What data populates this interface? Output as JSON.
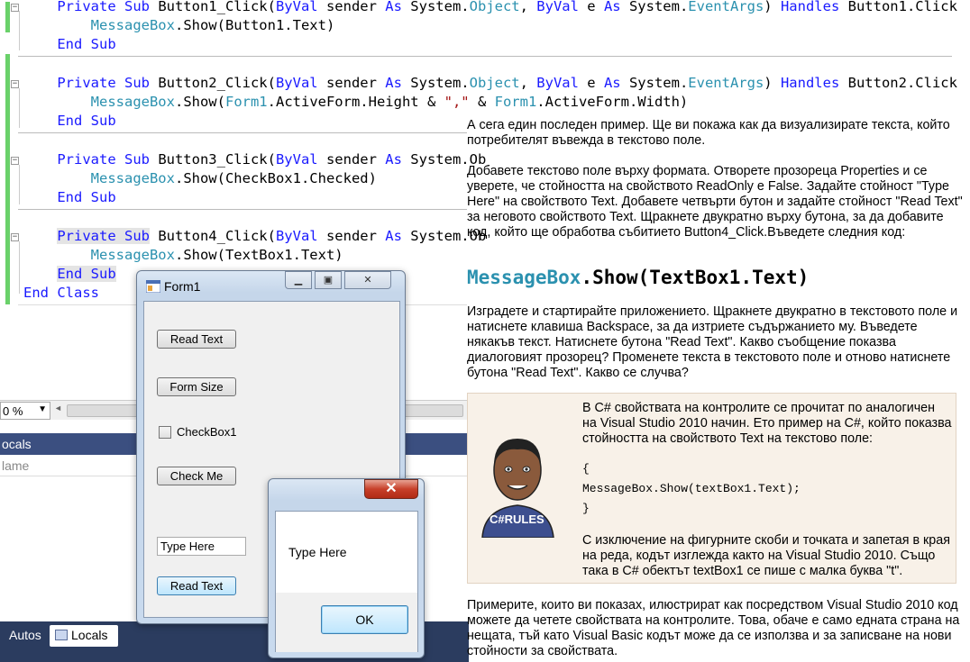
{
  "editor": {
    "lines": [
      {
        "segments": [
          {
            "t": "    "
          },
          {
            "t": "Private Sub",
            "c": "kw"
          },
          {
            "t": " Button1_Click("
          },
          {
            "t": "ByVal",
            "c": "kw"
          },
          {
            "t": " sender "
          },
          {
            "t": "As",
            "c": "kw"
          },
          {
            "t": " System."
          },
          {
            "t": "Object",
            "c": "ty"
          },
          {
            "t": ", "
          },
          {
            "t": "ByVal",
            "c": "kw"
          },
          {
            "t": " e "
          },
          {
            "t": "As",
            "c": "kw"
          },
          {
            "t": " System."
          },
          {
            "t": "EventArgs",
            "c": "ty"
          },
          {
            "t": ") "
          },
          {
            "t": "Handles",
            "c": "kw"
          },
          {
            "t": " Button1.Click"
          }
        ]
      },
      {
        "segments": [
          {
            "t": "        "
          },
          {
            "t": "MessageBox",
            "c": "ty"
          },
          {
            "t": ".Show(Button1.Text)"
          }
        ]
      },
      {
        "segments": [
          {
            "t": "    "
          },
          {
            "t": "End Sub",
            "c": "kw"
          }
        ]
      },
      {
        "segments": [
          {
            "t": "    "
          },
          {
            "t": "Private Sub",
            "c": "kw"
          },
          {
            "t": " Button2_Click("
          },
          {
            "t": "ByVal",
            "c": "kw"
          },
          {
            "t": " sender "
          },
          {
            "t": "As",
            "c": "kw"
          },
          {
            "t": " System."
          },
          {
            "t": "Object",
            "c": "ty"
          },
          {
            "t": ", "
          },
          {
            "t": "ByVal",
            "c": "kw"
          },
          {
            "t": " e "
          },
          {
            "t": "As",
            "c": "kw"
          },
          {
            "t": " System."
          },
          {
            "t": "EventArgs",
            "c": "ty"
          },
          {
            "t": ") "
          },
          {
            "t": "Handles",
            "c": "kw"
          },
          {
            "t": " Button2.Click"
          }
        ]
      },
      {
        "segments": [
          {
            "t": "        "
          },
          {
            "t": "MessageBox",
            "c": "ty"
          },
          {
            "t": ".Show("
          },
          {
            "t": "Form1",
            "c": "ty"
          },
          {
            "t": ".ActiveForm.Height & "
          },
          {
            "t": "\",\"",
            "c": "str"
          },
          {
            "t": " & "
          },
          {
            "t": "Form1",
            "c": "ty"
          },
          {
            "t": ".ActiveForm.Width)"
          }
        ]
      },
      {
        "segments": [
          {
            "t": "    "
          },
          {
            "t": "End Sub",
            "c": "kw"
          }
        ]
      },
      {
        "segments": [
          {
            "t": "    "
          },
          {
            "t": "Private Sub",
            "c": "kw"
          },
          {
            "t": " Button3_Click("
          },
          {
            "t": "ByVal",
            "c": "kw"
          },
          {
            "t": " sender "
          },
          {
            "t": "As",
            "c": "kw"
          },
          {
            "t": " System.Ob"
          }
        ]
      },
      {
        "segments": [
          {
            "t": "        "
          },
          {
            "t": "MessageBox",
            "c": "ty"
          },
          {
            "t": ".Show(CheckBox1.Checked)"
          }
        ]
      },
      {
        "segments": [
          {
            "t": "    "
          },
          {
            "t": "End Sub",
            "c": "kw"
          }
        ]
      },
      {
        "segments": [
          {
            "t": "    "
          },
          {
            "t": "Private Sub",
            "c": "kw",
            "hl": true
          },
          {
            "t": " Button4_Click("
          },
          {
            "t": "ByVal",
            "c": "kw"
          },
          {
            "t": " sender "
          },
          {
            "t": "As",
            "c": "kw"
          },
          {
            "t": " System.Ob"
          }
        ]
      },
      {
        "segments": [
          {
            "t": "        "
          },
          {
            "t": "MessageBox",
            "c": "ty"
          },
          {
            "t": ".Show(TextBox1.Text)"
          }
        ]
      },
      {
        "segments": [
          {
            "t": "    "
          },
          {
            "t": "End Sub",
            "c": "kw",
            "hl": true
          }
        ]
      },
      {
        "segments": [
          {
            "t": "End Class",
            "c": "kw"
          }
        ]
      }
    ]
  },
  "debug": {
    "zoom": "0 %",
    "locals_title": "ocals",
    "name_col": "lame",
    "tab_autos": "Autos",
    "tab_locals": "Locals"
  },
  "form1": {
    "title": "Form1",
    "read_text_btn": "Read Text",
    "form_size_btn": "Form Size",
    "checkbox_label": "CheckBox1",
    "check_me_btn": "Check Me",
    "textbox_value": "Type Here",
    "read_text_btn2": "Read Text"
  },
  "msgbox": {
    "message": "Type Here",
    "ok_label": "OK"
  },
  "article": {
    "p1": "А сега един последен пример. Ще ви покажа как да визуализирате текста, който потребителят въвежда в текстово поле.",
    "p2": "Добавете текстово поле върху формата. Отворете прозореца Properties и се уверете, че стойността на свойството ReadOnly е False. Задайте стойност \"Type Here\" на свойството Text. Добавете четвърти бутон и задайте стойност \"Read Text\" за неговото свойството Text. Щракнете двукратно върху бутона, за да добавите код, който ще обработва събитието Button4_Click.Въведете следния код:",
    "code_class": "MessageBox",
    "code_rest": ".Show(TextBox1.Text)",
    "p3": "Изградете и стартирайте приложението. Щракнете двукратно в текстовото поле и натиснете клавиша Backspace, за да изтриете съдържанието му. Въведете някакъв текст. Натиснете бутона \"Read Text\". Какво съобщение показва диалоговият прозорец? Променете текста в текстовото поле и отново натиснете бутона \"Read Text\". Какво се случва?",
    "tip_p1": "В C# свойствата на контролите се прочитат по аналогичен на Visual Studio 2010 начин. Ето пример на C#, който показва стойността на свойството Text на текстово поле:",
    "tip_code1": "{",
    "tip_code2": "MessageBox.Show(textBox1.Text);",
    "tip_code3": "}",
    "tip_p2": "С изключение на фигурните скоби и точката и запетая в края на реда, кодът изглежда както на Visual Studio 2010. Също така в C# обектът textBox1 се пише с малка буква \"t\".",
    "mascot_label": "C#RULES",
    "p4": "Примерите, които ви показах, илюстрират как посредством Visual Studio 2010 код можете да четете свойствата на контролите. Това, обаче е само едната страна на нещата, тъй като Visual Basic кодът може да се използва и за записване на нови стойности за свойствата."
  },
  "colors": {
    "keyword": "#1a1aff",
    "type": "#2b91af",
    "string": "#a31515",
    "change_bar": "#6ad16a"
  }
}
